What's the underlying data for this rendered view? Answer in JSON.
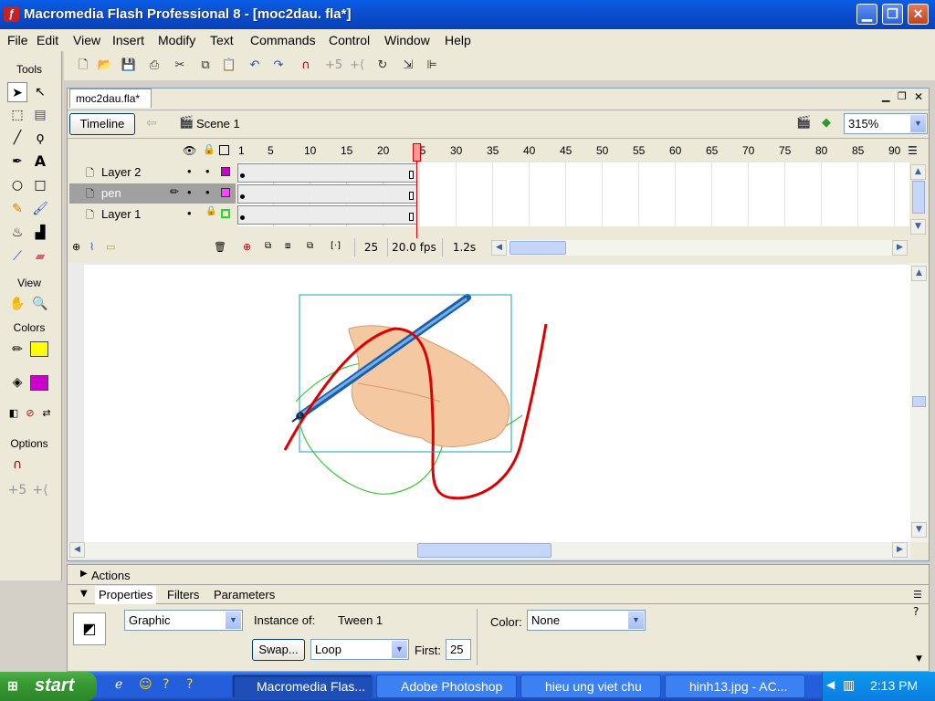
{
  "window": {
    "title": "Macromedia Flash Professional 8 - [moc2dau. fla*]"
  },
  "menu": [
    "File",
    "Edit",
    "View",
    "Insert",
    "Modify",
    "Text",
    "Commands",
    "Control",
    "Window",
    "Help"
  ],
  "tools": {
    "title": "Tools",
    "view": "View",
    "colors": "Colors",
    "options": "Options",
    "stroke_color": "#ffff00",
    "fill_color": "#cc00cc"
  },
  "document": {
    "tab": "moc2dau.fla*",
    "timeline_button": "Timeline",
    "scene": "Scene 1",
    "zoom": "315%"
  },
  "timeline": {
    "ruler": [
      "1",
      "5",
      "10",
      "15",
      "20",
      "25",
      "30",
      "35",
      "40",
      "45",
      "50",
      "55",
      "60",
      "65",
      "70",
      "75",
      "80",
      "85",
      "90"
    ],
    "current_frame": "25",
    "frame_rate": "20.0 fps",
    "elapsed": "1.2s",
    "layers": [
      {
        "name": "Layer 2",
        "color": "#cc00cc",
        "selected": false,
        "locked": false
      },
      {
        "name": "pen",
        "color": "#ff44ff",
        "selected": true,
        "locked": false
      },
      {
        "name": "Layer 1",
        "color": "#22dd22",
        "selected": false,
        "locked": true
      }
    ]
  },
  "panels": {
    "actions": "Actions",
    "tabs": [
      "Properties",
      "Filters",
      "Parameters"
    ],
    "symbol_type": "Graphic",
    "instance_label": "Instance of:",
    "instance_name": "Tween 1",
    "swap_button": "Swap...",
    "loop_option": "Loop",
    "first_label": "First:",
    "first_value": "25",
    "color_label": "Color:",
    "color_value": "None"
  },
  "taskbar": {
    "start": "start",
    "tasks": [
      "Macromedia Flas...",
      "Adobe Photoshop",
      "hieu ung viet chu",
      "hinh13.jpg - AC..."
    ],
    "clock": "2:13 PM"
  }
}
